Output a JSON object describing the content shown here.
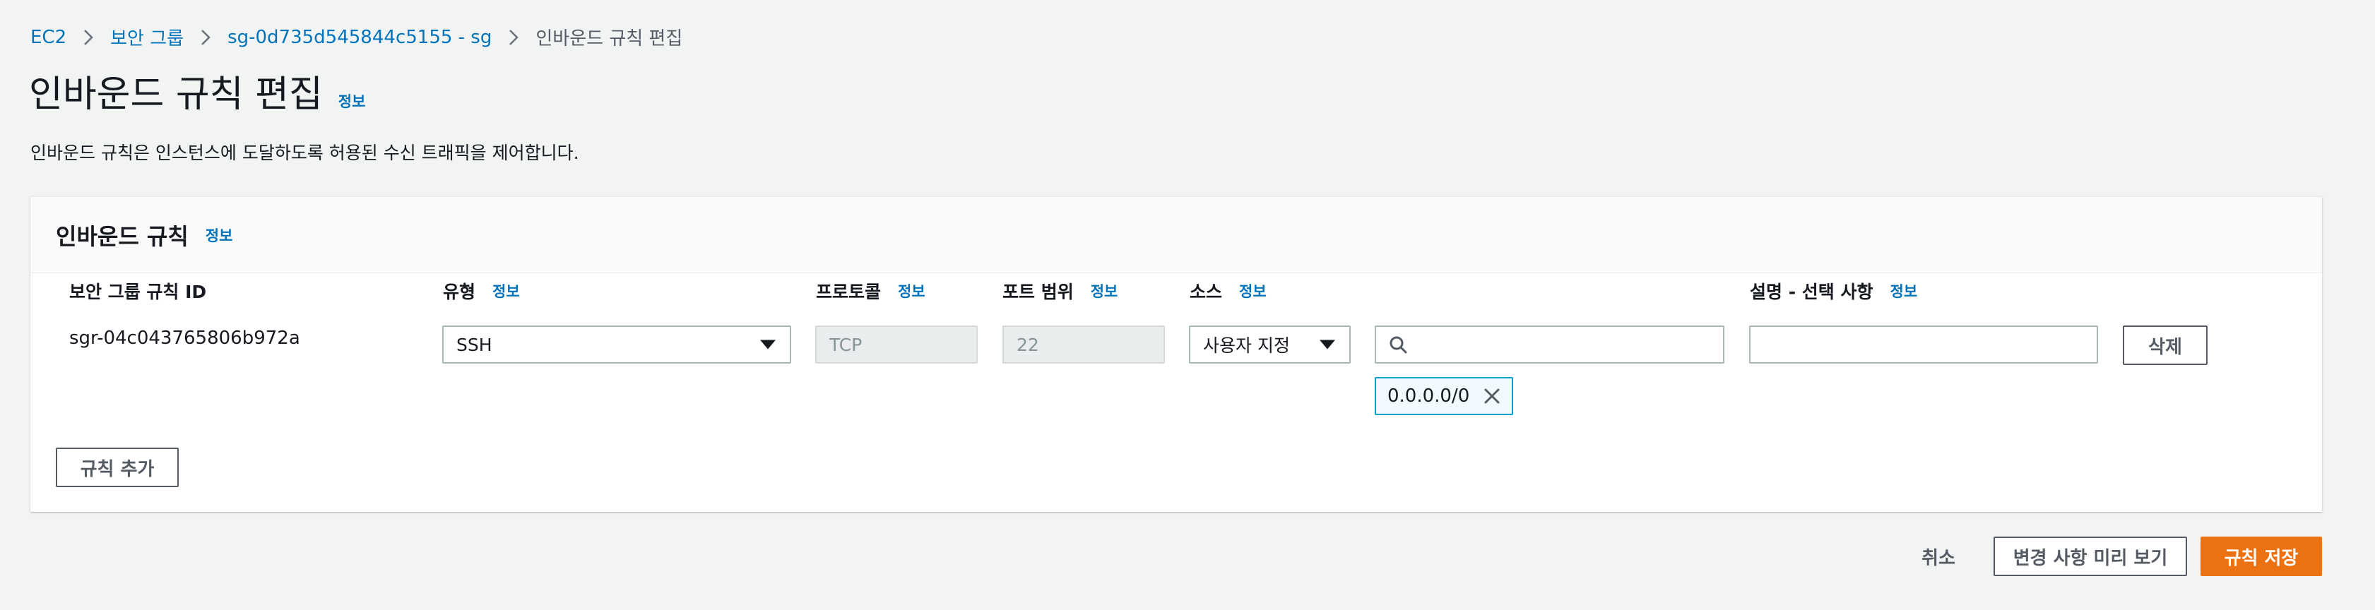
{
  "breadcrumb": {
    "items": [
      "EC2",
      "보안 그룹",
      "sg-0d735d545844c5155 - sg"
    ],
    "current": "인바운드 규칙 편집"
  },
  "page": {
    "title": "인바운드 규칙 편집",
    "info": "정보",
    "description": "인바운드 규칙은 인스턴스에 도달하도록 허용된 수신 트래픽을 제어합니다."
  },
  "panel": {
    "title": "인바운드 규칙",
    "info": "정보",
    "columns": {
      "rule_id": "보안 그룹 규칙 ID",
      "type": "유형",
      "protocol": "프로토콜",
      "port_range": "포트 범위",
      "source": "소스",
      "description": "설명 - 선택 사항",
      "info": "정보"
    },
    "rules": [
      {
        "rule_id": "sgr-04c043765806b972a",
        "type": "SSH",
        "protocol": "TCP",
        "port_range": "22",
        "source_type": "사용자 지정",
        "source_search_value": "",
        "source_token": "0.0.0.0/0",
        "description_value": "",
        "delete_label": "삭제"
      }
    ],
    "add_rule_label": "규칙 추가"
  },
  "footer": {
    "cancel_label": "취소",
    "preview_label": "변경 사항 미리 보기",
    "save_label": "규칙 저장"
  },
  "colors": {
    "link": "#0073bb",
    "primary": "#ec7211",
    "background": "#f2f3f3"
  }
}
